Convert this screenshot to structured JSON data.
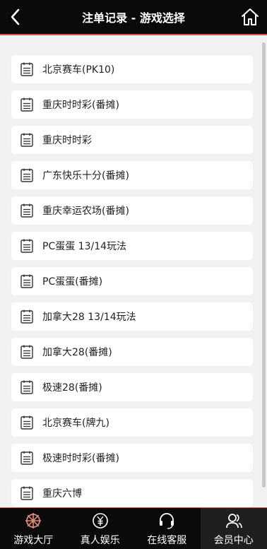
{
  "header": {
    "title": "注单记录 - 游戏选择"
  },
  "games": [
    {
      "label": "北京赛车(PK10)"
    },
    {
      "label": "重庆时时彩(番摊)"
    },
    {
      "label": "重庆时时彩"
    },
    {
      "label": "广东快乐十分(番摊)"
    },
    {
      "label": "重庆幸运农场(番摊)"
    },
    {
      "label": "PC蛋蛋 13/14玩法"
    },
    {
      "label": "PC蛋蛋(番摊)"
    },
    {
      "label": "加拿大28 13/14玩法"
    },
    {
      "label": "加拿大28(番摊)"
    },
    {
      "label": "极速28(番摊)"
    },
    {
      "label": "北京赛车(牌九)"
    },
    {
      "label": "极速时时彩(番摊)"
    },
    {
      "label": "重庆六博"
    }
  ],
  "tabs": [
    {
      "label": "游戏大厅",
      "icon": "ship-wheel-icon"
    },
    {
      "label": "真人娱乐",
      "icon": "yen-coin-icon"
    },
    {
      "label": "在线客服",
      "icon": "headset-icon"
    },
    {
      "label": "会员中心",
      "icon": "users-icon",
      "active": true
    }
  ],
  "colors": {
    "header_bg": "#0a0a0a",
    "accent_line": "#d9534f",
    "page_bg": "#f2f2f2",
    "active_tab_bg": "#1f1f1f"
  }
}
